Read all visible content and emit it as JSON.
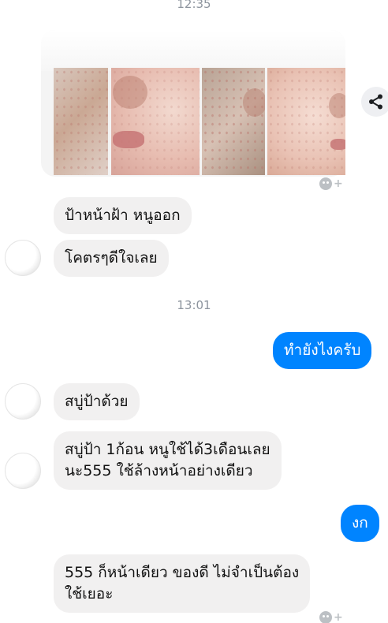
{
  "timestamps": {
    "top": "12:35",
    "middle": "13:01"
  },
  "photo_card": {
    "photo_count": 4
  },
  "icons": {
    "share": "share-icon",
    "react": "add-reaction-icon",
    "avatar": "contact-avatar"
  },
  "messages": [
    {
      "side": "in",
      "text": "ป้าหน้าฝ้า หนูออก"
    },
    {
      "side": "in",
      "text": "โคตรๆดีใจเลย"
    },
    {
      "side": "out",
      "text": "ทำยังไงครับ"
    },
    {
      "side": "in",
      "text": "สบู่ป้าด้วย"
    },
    {
      "side": "in",
      "text": "สบู่ป้า 1ก้อน หนูใช้ได้3เดือนเลย\nนะ555 ใช้ล้างหน้าอย่างเดียว"
    },
    {
      "side": "out",
      "text": "งก"
    },
    {
      "side": "in",
      "text": "555 ก็หน้าเดียว ของดี ไม่จำเป็นต้อง\nใช้เยอะ"
    }
  ],
  "colors": {
    "outgoing_bubble": "#0084ff",
    "incoming_bubble": "#f1f0f0",
    "timestamp": "#8d949e"
  }
}
